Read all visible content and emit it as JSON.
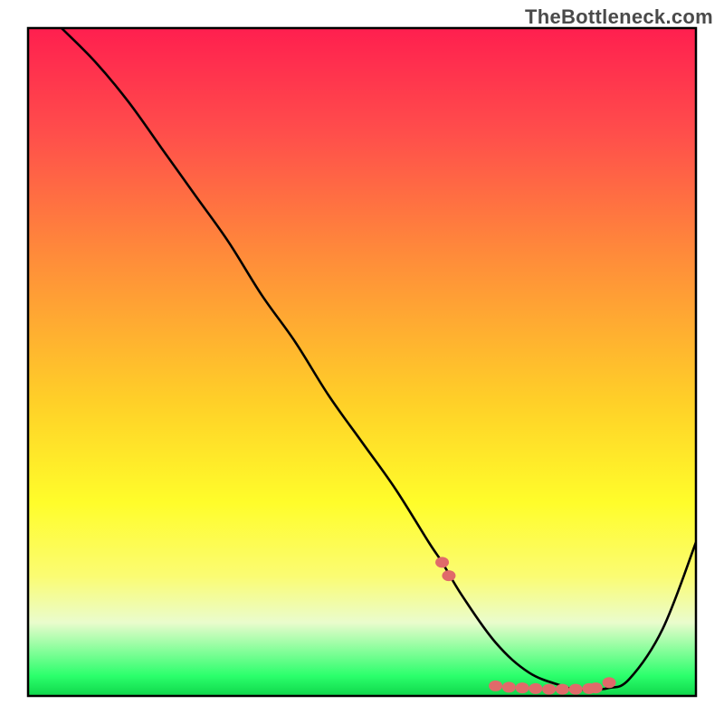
{
  "watermark": "TheBottleneck.com",
  "colors": {
    "curve": "#000000",
    "markers": "#e06a6a",
    "frame": "#000000"
  },
  "chart_data": {
    "type": "line",
    "title": "",
    "xlabel": "",
    "ylabel": "",
    "xlim": [
      0,
      100
    ],
    "ylim": [
      0,
      100
    ],
    "grid": false,
    "legend": false,
    "curve": {
      "name": "bottleneck-curve",
      "x": [
        5,
        10,
        15,
        20,
        25,
        30,
        35,
        40,
        45,
        50,
        55,
        60,
        62,
        65,
        70,
        75,
        80,
        82,
        85,
        87,
        90,
        95,
        100
      ],
      "y": [
        100,
        95,
        89,
        82,
        75,
        68,
        60,
        53,
        45,
        38,
        31,
        23,
        20,
        15,
        8,
        3.5,
        1.5,
        1,
        1,
        1.2,
        2.5,
        10,
        23
      ]
    },
    "markers": {
      "name": "highlight-points",
      "x": [
        62,
        63,
        70,
        72,
        74,
        76,
        78,
        80,
        82,
        84,
        85,
        87
      ],
      "y": [
        20,
        18,
        1.5,
        1.3,
        1.2,
        1.1,
        1.0,
        1.0,
        1.0,
        1.1,
        1.2,
        2.0
      ]
    }
  }
}
